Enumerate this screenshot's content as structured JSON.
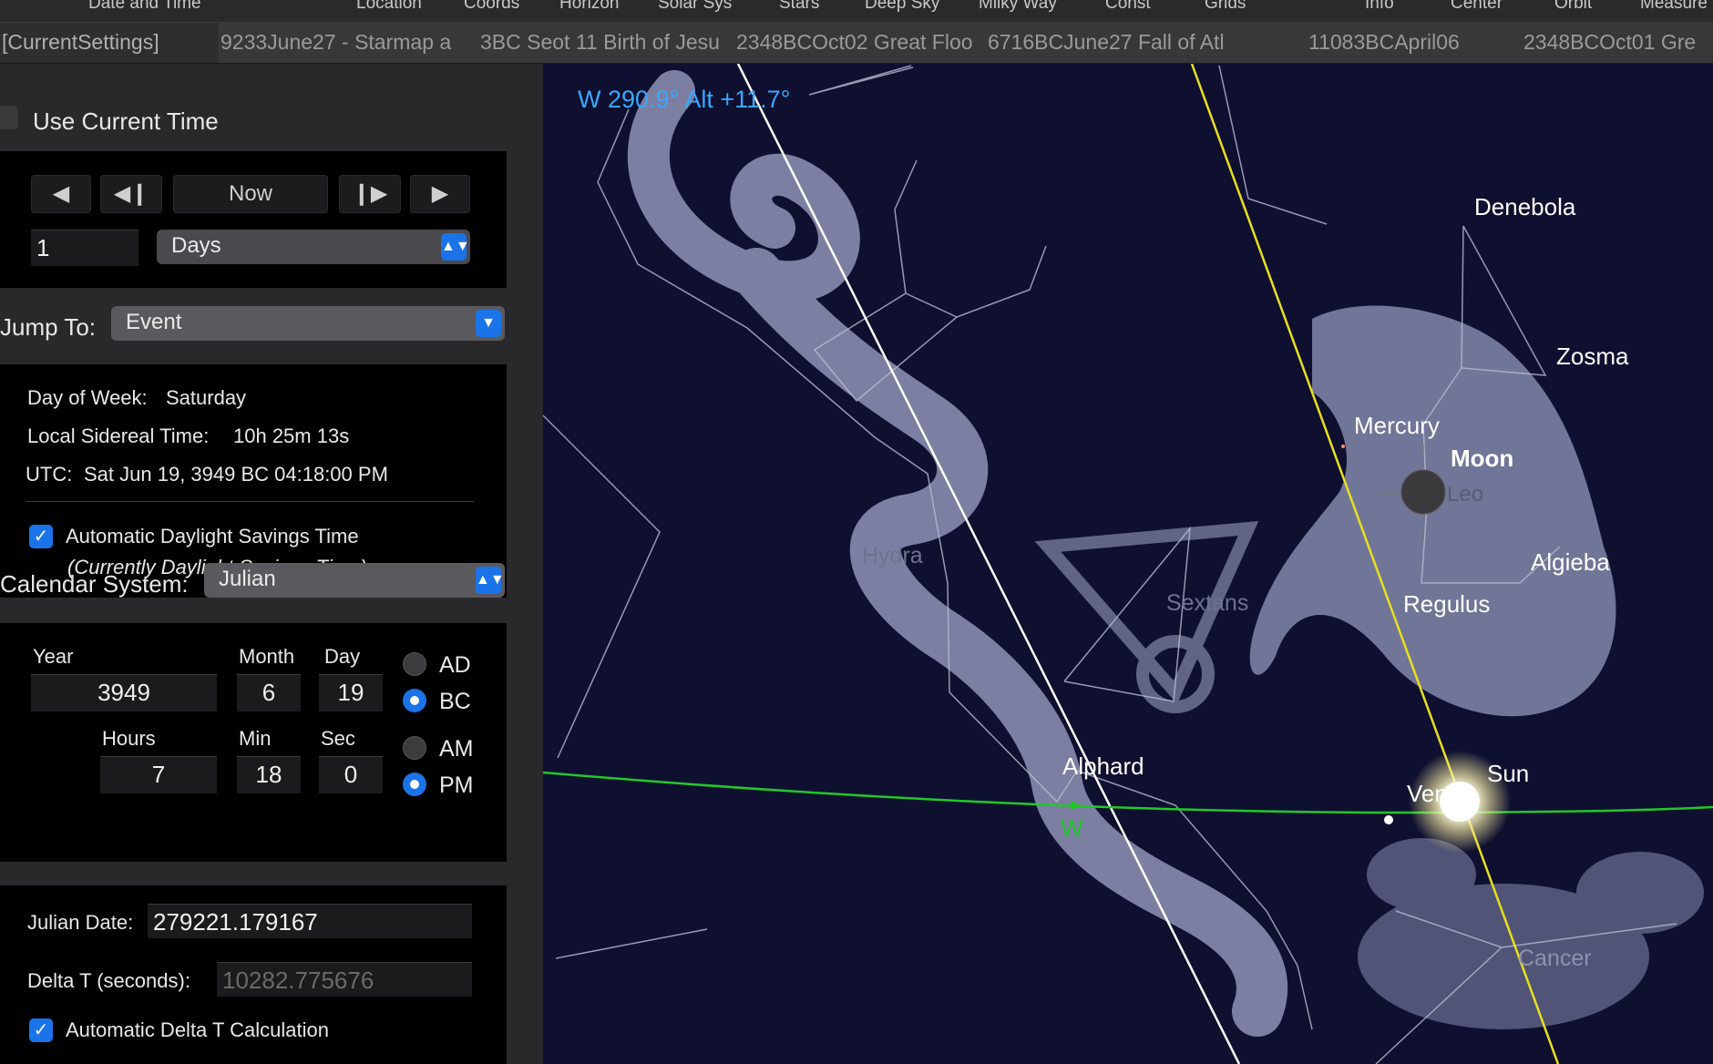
{
  "menu": [
    "Date and Time",
    "Location",
    "Coords",
    "Horizon",
    "Solar Sys",
    "Stars",
    "Deep Sky",
    "Milky Way",
    "Const",
    "Grids",
    "Info",
    "Center",
    "Orbit",
    "Measure"
  ],
  "settings": {
    "current": "[CurrentSettings]",
    "items": [
      "9233June27 - Starmap a",
      "3BC Seot 11 Birth of Jesu",
      "2348BCOct02 Great Floo",
      "6716BCJune27 Fall of Atl",
      "11083BCApril06",
      "2348BCOct01 Gre"
    ]
  },
  "panel": {
    "use_current_time": "Use Current Time",
    "step_value": "1",
    "step_unit": "Days",
    "now_label": "Now",
    "jump_to_label": "Jump To:",
    "jump_to_value": "Event",
    "day_of_week_label": "Day of Week:",
    "day_of_week": "Saturday",
    "lst_label": "Local Sidereal Time:",
    "lst": "10h 25m 13s",
    "utc_label": "UTC:",
    "utc": "Sat Jun 19, 3949 BC 04:18:00 PM",
    "auto_dst": "Automatic Daylight Savings Time",
    "dst_note": "(Currently Daylight Savings Time)",
    "calendar_label": "Calendar System:",
    "calendar_value": "Julian",
    "year_label": "Year",
    "month_label": "Month",
    "day_label": "Day",
    "year": "3949",
    "month": "6",
    "day": "19",
    "ad": "AD",
    "bc": "BC",
    "hours_label": "Hours",
    "min_label": "Min",
    "sec_label": "Sec",
    "hours": "7",
    "min": "18",
    "sec": "0",
    "am": "AM",
    "pm": "PM",
    "jd_label": "Julian Date:",
    "jd": "279221.179167",
    "deltat_label": "Delta T (seconds):",
    "deltat": "10282.775676",
    "auto_deltat": "Automatic Delta T Calculation"
  },
  "sky": {
    "readout": "W 290.9° Alt +11.7°",
    "labels": {
      "denebola": "Denebola",
      "zosma": "Zosma",
      "mercury": "Mercury",
      "moon": "Moon",
      "leo": "Leo",
      "algieba": "Algieba",
      "regulus": "Regulus",
      "hydra": "Hydra",
      "sextans": "Sextans",
      "alphard": "Alphard",
      "sun": "Sun",
      "venus": "Venus",
      "west": "W",
      "cancer": "Cancer"
    },
    "colors": {
      "sky": "#0f1030",
      "ecliptic": "#e8e020",
      "horizon": "#22c82a",
      "readout": "#3aa7ff"
    }
  }
}
